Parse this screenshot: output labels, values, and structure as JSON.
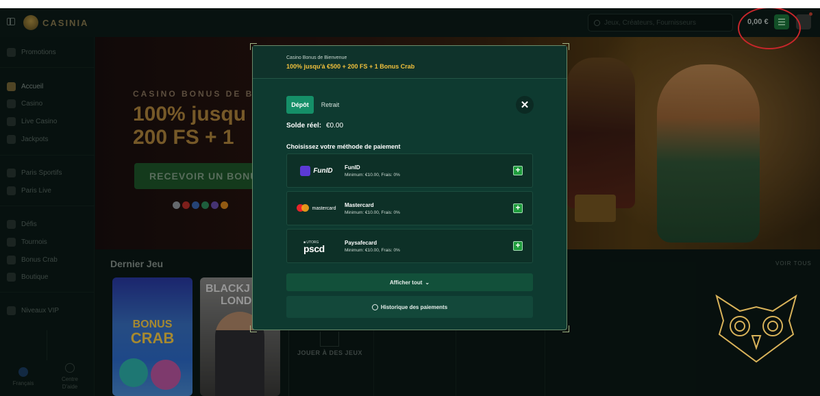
{
  "topbar": {
    "logo_text": "CASINIA",
    "search_placeholder": "Jeux, Créateurs, Fournisseurs",
    "balance": "0,00 €"
  },
  "sidebar": {
    "items": [
      {
        "label": "Promotions"
      },
      {
        "label": "Accueil"
      },
      {
        "label": "Casino"
      },
      {
        "label": "Live Casino"
      },
      {
        "label": "Jackpots"
      },
      {
        "label": "Paris Sportifs"
      },
      {
        "label": "Paris Live"
      },
      {
        "label": "Défis"
      },
      {
        "label": "Tournois"
      },
      {
        "label": "Bonus Crab"
      },
      {
        "label": "Boutique"
      },
      {
        "label": "Niveaux VIP"
      }
    ],
    "language": "Français",
    "help_line1": "Centre",
    "help_line2": "D'aide"
  },
  "hero": {
    "subtitle": "CASINO BONUS DE BIE",
    "title_line1": "100% jusqu",
    "title_line2": "200 FS + 1",
    "cta": "RECEVOIR UN BONU"
  },
  "games": {
    "section_title": "Dernier Jeu",
    "see_all": "VOIR TOUS",
    "bonus_crab_word1": "BONUS",
    "bonus_crab_word2": "CRAB",
    "blackjack_line1": "BLACKJ",
    "blackjack_line2": "LONDO",
    "empty_text": "JOUER À DES JEUX"
  },
  "modal": {
    "header_small": "Casino Bonus de Bienvenue",
    "header_bonus": "100% jusqu'à €500 + 200 FS + 1 Bonus Crab",
    "tab_deposit": "Dépôt",
    "tab_withdraw": "Retrait",
    "close_glyph": "✕",
    "balance_label": "Solde réel:",
    "balance_value": "€0.00",
    "method_title": "Choisissez votre méthode de paiement",
    "methods": [
      {
        "logo": "FunID",
        "name": "FunID",
        "details": "Minimum: €10.00, Frais: 0%"
      },
      {
        "logo": "mastercard",
        "name": "Mastercard",
        "details": "Minimum: €10.00, Frais: 0%"
      },
      {
        "logo": "pscd",
        "logo_small": "■ UTORG",
        "name": "Paysafecard",
        "details": "Minimum: €10.00, Frais: 0%"
      }
    ],
    "show_all": "Afficher tout",
    "history": "Historique des paiements"
  },
  "colors": {
    "accent_green": "#158f68",
    "bonus_gold": "#f2c13d",
    "modal_bg": "#0e3a30",
    "highlight_red": "#c8262b"
  },
  "icons": [
    "sidebar-toggle-icon",
    "search-icon",
    "wallet-icon",
    "close-icon",
    "plus-icon",
    "chevron-down-icon",
    "clock-icon",
    "owl-logo"
  ]
}
